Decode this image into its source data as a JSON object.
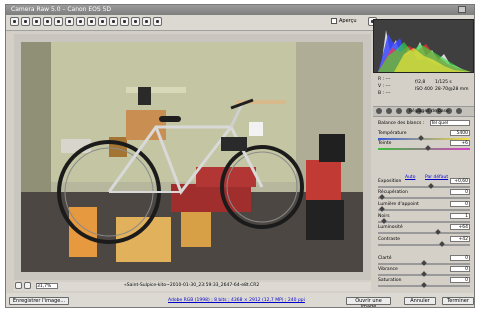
{
  "window": {
    "title": "Camera Raw 5.0 – Canon EOS 5D"
  },
  "toolbar": {
    "preview_label": "Aperçu",
    "preview_checked": true
  },
  "photo": {
    "status": "«Saint-Sulpice-kito~2010-01-30_23:59:33_2647-64-e8t.CR2",
    "zoom": "31,7%"
  },
  "histogram": {
    "r_label": "R : ---",
    "g_label": "V : ---",
    "b_label": "B : ---",
    "aperture": "f/2,8",
    "shutter": "1/125 s",
    "iso": "ISO 400",
    "focal": "28-70@28 mm"
  },
  "panel": {
    "title": "Réglages de base",
    "wb_label": "Balance des blancs :",
    "wb_value": "Tel quel",
    "auto_link": "Auto",
    "default_link": "Par défaut",
    "rows": [
      {
        "label": "Température",
        "value": "5400",
        "pos": 0.47
      },
      {
        "label": "Teinte",
        "value": "+6",
        "pos": 0.55
      },
      {
        "label": "Exposition",
        "value": "+0,60",
        "pos": 0.58
      },
      {
        "label": "Récupération",
        "value": "0",
        "pos": 0.02
      },
      {
        "label": "Lumière d'appoint",
        "value": "0",
        "pos": 0.02
      },
      {
        "label": "Noirs",
        "value": "1",
        "pos": 0.05
      },
      {
        "label": "Luminosité",
        "value": "+64",
        "pos": 0.66
      },
      {
        "label": "Contraste",
        "value": "+42",
        "pos": 0.7
      },
      {
        "label": "Clarté",
        "value": "0",
        "pos": 0.5
      },
      {
        "label": "Vibrance",
        "value": "0",
        "pos": 0.5
      },
      {
        "label": "Saturation",
        "value": "0",
        "pos": 0.5
      }
    ]
  },
  "footer": {
    "save_label": "Enregistrer l'image...",
    "info_link": "Adobe RGB (1998) ; 8 bits ; 4368 × 2912 (12,7 MP) ; 240 ppi",
    "open_label": "Ouvrir une image",
    "cancel_label": "Annuler",
    "done_label": "Terminer"
  }
}
